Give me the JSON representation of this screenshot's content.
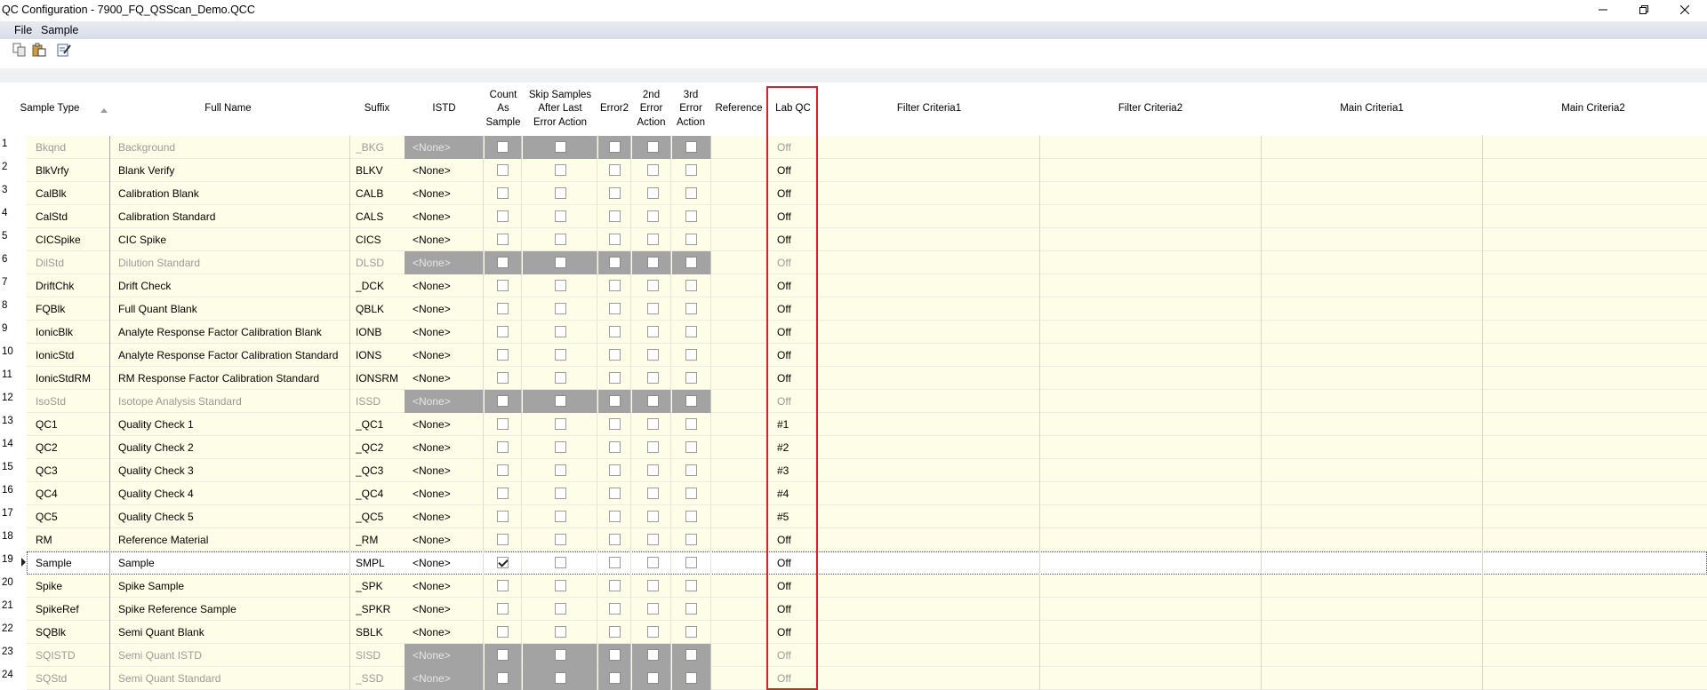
{
  "window": {
    "title": "QC Configuration - 7900_FQ_QSScan_Demo.QCC"
  },
  "menu": [
    {
      "label": "File"
    },
    {
      "label": "Sample"
    }
  ],
  "toolbar": {
    "buttons": [
      {
        "icon": "copy-icon"
      },
      {
        "icon": "paste-icon"
      },
      {
        "icon": "edit-icon"
      }
    ]
  },
  "columns": {
    "sample_type": "Sample Type",
    "full_name": "Full Name",
    "suffix": "Suffix",
    "istd": "ISTD",
    "count_as_sample": [
      "Count",
      "As",
      "Sample"
    ],
    "skip_samples": [
      "Skip Samples",
      "After Last",
      "Error Action"
    ],
    "error2": "Error2",
    "error2nd": [
      "2nd",
      "Error",
      "Action"
    ],
    "error3rd": [
      "3rd",
      "Error",
      "Action"
    ],
    "reference": "Reference",
    "lab_qc": "Lab QC",
    "filter1": "Filter Criteria1",
    "filter2": "Filter Criteria2",
    "main1": "Main Criteria1",
    "main2": "Main Criteria2"
  },
  "rows": [
    {
      "n": "1",
      "type": "Bkqnd",
      "name": "Background",
      "suffix": "_BKG",
      "istd": "<None>",
      "labqc": "Off",
      "disabled": true,
      "count": false
    },
    {
      "n": "2",
      "type": "BlkVrfy",
      "name": "Blank Verify",
      "suffix": "BLKV",
      "istd": "<None>",
      "labqc": "Off",
      "disabled": false,
      "count": false
    },
    {
      "n": "3",
      "type": "CalBlk",
      "name": "Calibration Blank",
      "suffix": "CALB",
      "istd": "<None>",
      "labqc": "Off",
      "disabled": false,
      "count": false
    },
    {
      "n": "4",
      "type": "CalStd",
      "name": "Calibration Standard",
      "suffix": "CALS",
      "istd": "<None>",
      "labqc": "Off",
      "disabled": false,
      "count": false
    },
    {
      "n": "5",
      "type": "CICSpike",
      "name": "CIC Spike",
      "suffix": "CICS",
      "istd": "<None>",
      "labqc": "Off",
      "disabled": false,
      "count": false
    },
    {
      "n": "6",
      "type": "DilStd",
      "name": "Dilution Standard",
      "suffix": "DLSD",
      "istd": "<None>",
      "labqc": "Off",
      "disabled": true,
      "count": false
    },
    {
      "n": "7",
      "type": "DriftChk",
      "name": "Drift Check",
      "suffix": "_DCK",
      "istd": "<None>",
      "labqc": "Off",
      "disabled": false,
      "count": false
    },
    {
      "n": "8",
      "type": "FQBlk",
      "name": "Full Quant Blank",
      "suffix": "QBLK",
      "istd": "<None>",
      "labqc": "Off",
      "disabled": false,
      "count": false
    },
    {
      "n": "9",
      "type": "IonicBlk",
      "name": "Analyte Response Factor Calibration Blank",
      "suffix": "IONB",
      "istd": "<None>",
      "labqc": "Off",
      "disabled": false,
      "count": false
    },
    {
      "n": "10",
      "type": "IonicStd",
      "name": "Analyte Response Factor Calibration Standard",
      "suffix": "IONS",
      "istd": "<None>",
      "labqc": "Off",
      "disabled": false,
      "count": false
    },
    {
      "n": "11",
      "type": "IonicStdRM",
      "name": "RM Response Factor Calibration Standard",
      "suffix": "IONSRM",
      "istd": "<None>",
      "labqc": "Off",
      "disabled": false,
      "count": false
    },
    {
      "n": "12",
      "type": "IsoStd",
      "name": "Isotope Analysis Standard",
      "suffix": "ISSD",
      "istd": "<None>",
      "labqc": "Off",
      "disabled": true,
      "count": false
    },
    {
      "n": "13",
      "type": "QC1",
      "name": "Quality Check 1",
      "suffix": "_QC1",
      "istd": "<None>",
      "labqc": "#1",
      "disabled": false,
      "count": false
    },
    {
      "n": "14",
      "type": "QC2",
      "name": "Quality Check 2",
      "suffix": "_QC2",
      "istd": "<None>",
      "labqc": "#2",
      "disabled": false,
      "count": false
    },
    {
      "n": "15",
      "type": "QC3",
      "name": "Quality Check 3",
      "suffix": "_QC3",
      "istd": "<None>",
      "labqc": "#3",
      "disabled": false,
      "count": false
    },
    {
      "n": "16",
      "type": "QC4",
      "name": "Quality Check 4",
      "suffix": "_QC4",
      "istd": "<None>",
      "labqc": "#4",
      "disabled": false,
      "count": false
    },
    {
      "n": "17",
      "type": "QC5",
      "name": "Quality Check 5",
      "suffix": "_QC5",
      "istd": "<None>",
      "labqc": "#5",
      "disabled": false,
      "count": false
    },
    {
      "n": "18",
      "type": "RM",
      "name": "Reference Material",
      "suffix": "_RM",
      "istd": "<None>",
      "labqc": "Off",
      "disabled": false,
      "count": false
    },
    {
      "n": "19",
      "type": "Sample",
      "name": "Sample",
      "suffix": "SMPL",
      "istd": "<None>",
      "labqc": "Off",
      "disabled": false,
      "count": true,
      "selected": true
    },
    {
      "n": "20",
      "type": "Spike",
      "name": "Spike Sample",
      "suffix": "_SPK",
      "istd": "<None>",
      "labqc": "Off",
      "disabled": false,
      "count": false
    },
    {
      "n": "21",
      "type": "SpikeRef",
      "name": "Spike Reference Sample",
      "suffix": "_SPKR",
      "istd": "<None>",
      "labqc": "Off",
      "disabled": false,
      "count": false
    },
    {
      "n": "22",
      "type": "SQBlk",
      "name": "Semi Quant Blank",
      "suffix": "SBLK",
      "istd": "<None>",
      "labqc": "Off",
      "disabled": false,
      "count": false
    },
    {
      "n": "23",
      "type": "SQISTD",
      "name": "Semi Quant ISTD",
      "suffix": "SISD",
      "istd": "<None>",
      "labqc": "Off",
      "disabled": true,
      "count": false
    },
    {
      "n": "24",
      "type": "SQStd",
      "name": "Semi Quant Standard",
      "suffix": "_SSD",
      "istd": "<None>",
      "labqc": "Off",
      "disabled": true,
      "count": false
    }
  ]
}
